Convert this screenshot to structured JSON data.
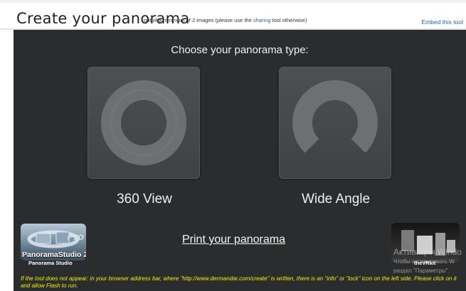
{
  "header": {
    "title": "Create your panorama",
    "subtitle_before": "out of a minimum of 2 images (please use the",
    "subtitle_link": "sharing",
    "subtitle_after": "tool otherwise)",
    "embed_link": "Embed this tool"
  },
  "main": {
    "heading": "Choose your panorama type:",
    "options": [
      {
        "label": "360 View",
        "icon": "full-ring-icon"
      },
      {
        "label": "Wide Angle",
        "icon": "partial-ring-icon"
      }
    ],
    "print_link": "Print your panorama"
  },
  "sponsors": {
    "left": {
      "logo_text": "PanoramaStudio 2",
      "logo_badge": "Pro",
      "caption": "Panorama Studio"
    },
    "right": {
      "caption": "theVRkit"
    }
  },
  "overlay": {
    "line1": "Активация Windo",
    "line2": "Чтобы активировать W",
    "line3": "раздел \"Параметры\"."
  },
  "note": "If the tool does not appear: in your browser address bar, where \"http://www.dermandar.com/create\" is written, there is an \"info\" or \"lock\" icon on the left side. Please click on it and allow Flash to run.",
  "colors": {
    "stage_bg": "#2a2c2e",
    "card_bg": "#47494b",
    "link": "#2a63b1",
    "note": "#f4f000"
  }
}
